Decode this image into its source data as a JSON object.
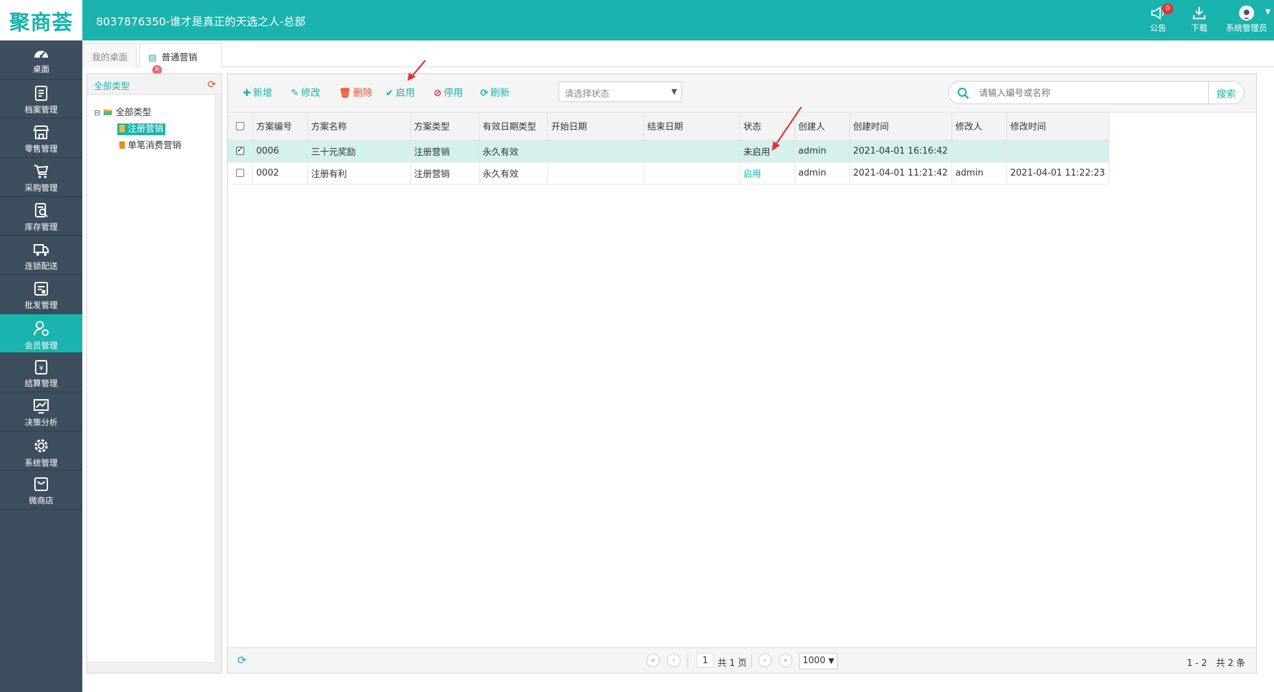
{
  "header": {
    "logo": "聚商荟",
    "title": "8037876350-谁才是真正的天选之人-总部",
    "notice_label": "公告",
    "notice_count": "0",
    "download_label": "下载",
    "user_label": "系统管理员"
  },
  "nav": [
    {
      "label": "桌面",
      "icon": "dashboard-icon"
    },
    {
      "label": "档案管理",
      "icon": "document-icon"
    },
    {
      "label": "零售管理",
      "icon": "store-icon"
    },
    {
      "label": "采购管理",
      "icon": "cart-icon"
    },
    {
      "label": "库存管理",
      "icon": "inventory-icon"
    },
    {
      "label": "连锁配送",
      "icon": "truck-icon"
    },
    {
      "label": "批发管理",
      "icon": "wholesale-icon"
    },
    {
      "label": "会员管理",
      "icon": "member-icon"
    },
    {
      "label": "结算管理",
      "icon": "settlement-icon"
    },
    {
      "label": "决策分析",
      "icon": "chart-icon"
    },
    {
      "label": "系统管理",
      "icon": "gear-icon"
    },
    {
      "label": "微商店",
      "icon": "shop-bag-icon"
    }
  ],
  "tabs": {
    "desktop": "我的桌面",
    "marketing": "普通营销"
  },
  "tree": {
    "header": "全部类型",
    "root": "全部类型",
    "children": [
      "注册营销",
      "单笔消费营销"
    ]
  },
  "toolbar": {
    "add": "新增",
    "edit": "修改",
    "delete": "删除",
    "enable": "启用",
    "disable": "停用",
    "refresh": "刷新",
    "status_placeholder": "请选择状态",
    "search_placeholder": "请输入编号或名称",
    "search": "搜索"
  },
  "table": {
    "columns": [
      "方案编号",
      "方案名称",
      "方案类型",
      "有效日期类型",
      "开始日期",
      "结束日期",
      "状态",
      "创建人",
      "创建时间",
      "修改人",
      "修改时间"
    ],
    "rows": [
      {
        "checked": true,
        "id": "0006",
        "name": "三十元奖励",
        "type": "注册营销",
        "valid": "永久有效",
        "start": "",
        "end": "",
        "status": "未启用",
        "creator": "admin",
        "created": "2021-04-01 16:16:42",
        "modifier": "",
        "modified": ""
      },
      {
        "checked": false,
        "id": "0002",
        "name": "注册有利",
        "type": "注册营销",
        "valid": "永久有效",
        "start": "",
        "end": "",
        "status": "启用",
        "creator": "admin",
        "created": "2021-04-01 11:21:42",
        "modifier": "admin",
        "modified": "2021-04-01 11:22:23"
      }
    ]
  },
  "pager": {
    "page": "1",
    "total_pages": "共 1 页",
    "page_size": "1000",
    "info": "1 - 2　共 2 条"
  },
  "colors": {
    "brand": "#1ab3ad",
    "nav_bg": "#3d4e5f",
    "selected_row": "#d4f1ee",
    "annotation_arrow": "#e8302f"
  }
}
